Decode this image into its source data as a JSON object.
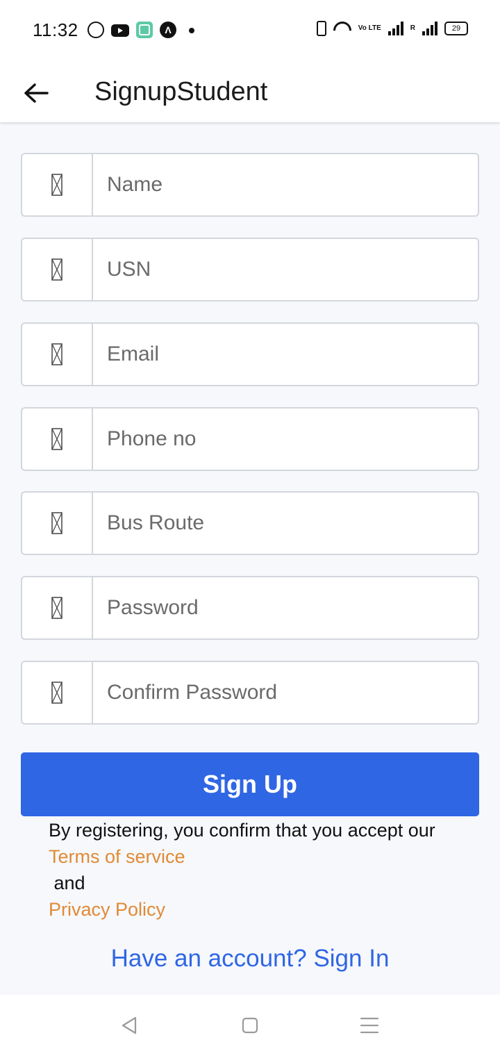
{
  "status_bar": {
    "time": "11:32",
    "icons_left": [
      "whatsapp-icon",
      "youtube-icon",
      "app-icon",
      "a-logo-icon",
      "notification-dot-icon"
    ],
    "icons_right": [
      "vibrate-icon",
      "wifi-icon",
      "volte-icon",
      "signal-icon",
      "signal-roaming-icon",
      "battery-icon"
    ],
    "volte_label": "Vo LTE",
    "roaming_label": "R",
    "battery": "29"
  },
  "app_bar": {
    "back_icon": "arrow-left-icon",
    "title": "SignupStudent"
  },
  "form": {
    "fields": [
      {
        "placeholder": "Name",
        "value": ""
      },
      {
        "placeholder": "USN",
        "value": ""
      },
      {
        "placeholder": "Email",
        "value": ""
      },
      {
        "placeholder": "Phone no",
        "value": ""
      },
      {
        "placeholder": "Bus Route",
        "value": ""
      },
      {
        "placeholder": "Password",
        "value": ""
      },
      {
        "placeholder": "Confirm Password",
        "value": ""
      }
    ],
    "field_icon": "missing-glyph-icon",
    "submit_label": "Sign Up"
  },
  "legal": {
    "intro": "By registering, you confirm that you accept our",
    "terms": "Terms of service",
    "conjunction": " and",
    "privacy": "Privacy Policy"
  },
  "signin_prompt": "Have an account? Sign In",
  "nav_bar": {
    "icons": [
      "back-triangle-icon",
      "home-square-icon",
      "menu-lines-icon"
    ]
  },
  "colors": {
    "accent": "#2f66e4",
    "link_orange": "#e08a36",
    "background": "#f6f8fc",
    "border": "#d3d6dc"
  }
}
